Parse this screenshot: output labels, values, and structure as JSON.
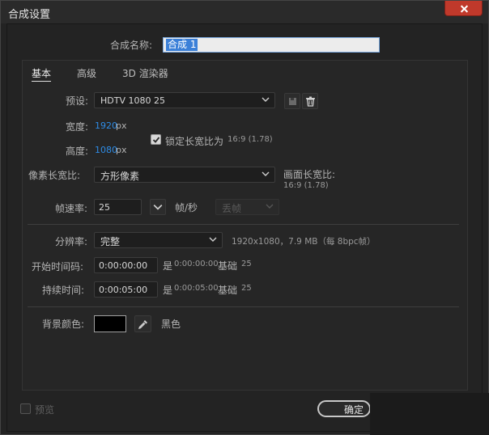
{
  "window": {
    "title": "合成设置"
  },
  "composition_name": {
    "label": "合成名称:",
    "value": "合成 1"
  },
  "tabs": [
    {
      "label": "基本",
      "active": true
    },
    {
      "label": "高级",
      "active": false
    },
    {
      "label": "3D 渲染器",
      "active": false
    }
  ],
  "preset": {
    "label": "预设:",
    "value": "HDTV 1080 25"
  },
  "width": {
    "label": "宽度:",
    "value": "1920",
    "unit": "px"
  },
  "height": {
    "label": "高度:",
    "value": "1080",
    "unit": "px"
  },
  "lock_aspect": {
    "label": "锁定长宽比为",
    "ratio": "16:9 (1.78)",
    "checked": true
  },
  "pixel_aspect": {
    "label": "像素长宽比:",
    "value": "方形像素"
  },
  "frame_aspect": {
    "label": "画面长宽比:",
    "value": "16:9 (1.78)"
  },
  "frame_rate": {
    "label": "帧速率:",
    "value": "25",
    "unit": "帧/秒",
    "drop_frame": "丢帧"
  },
  "resolution": {
    "label": "分辨率:",
    "value": "完整",
    "info": "1920x1080，7.9 MB（每 8bpc帧）"
  },
  "start_timecode": {
    "label": "开始时间码:",
    "value": "0:00:00:00",
    "is_label": "是",
    "is_value": "0:00:00:00",
    "base_label": "基础",
    "base_value": "25"
  },
  "duration": {
    "label": "持续时间:",
    "value": "0:00:05:00",
    "is_label": "是",
    "is_value": "0:00:05:00",
    "base_label": "基础",
    "base_value": "25"
  },
  "background": {
    "label": "背景颜色:",
    "color": "#000000",
    "name": "黑色"
  },
  "preview": {
    "label": "预览",
    "checked": false
  },
  "ok_button": {
    "label": "确定"
  },
  "colors": {
    "accent_blue": "#2e8ce6",
    "selection": "#3b80d8",
    "close": "#c0392b"
  },
  "icons": [
    "close-icon",
    "chevron-down-icon",
    "save-preset-icon",
    "trash-icon",
    "checkmark-icon",
    "eyedropper-icon"
  ]
}
